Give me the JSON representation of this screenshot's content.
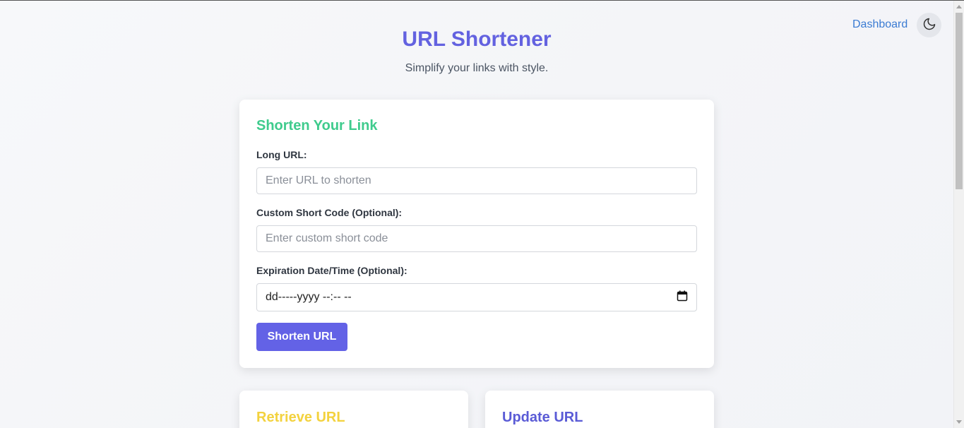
{
  "nav": {
    "dashboard_label": "Dashboard",
    "theme_icon": "moon-icon"
  },
  "header": {
    "title": "URL Shortener",
    "subtitle": "Simplify your links with style."
  },
  "shorten_card": {
    "title": "Shorten Your Link",
    "long_url_label": "Long URL:",
    "long_url_placeholder": "Enter URL to shorten",
    "long_url_value": "",
    "custom_code_label": "Custom Short Code (Optional):",
    "custom_code_placeholder": "Enter custom short code",
    "custom_code_value": "",
    "expiration_label": "Expiration Date/Time (Optional):",
    "expiration_value": "dd-----yyyy --:-- --",
    "submit_label": "Shorten URL"
  },
  "retrieve_card": {
    "title": "Retrieve URL"
  },
  "update_card": {
    "title": "Update URL"
  },
  "colors": {
    "accent": "#6362e6",
    "title": "#6362e0",
    "card_title_green": "#3fcb8d",
    "retrieve_yellow": "#f3d23e",
    "link_blue": "#3b7bd3"
  }
}
